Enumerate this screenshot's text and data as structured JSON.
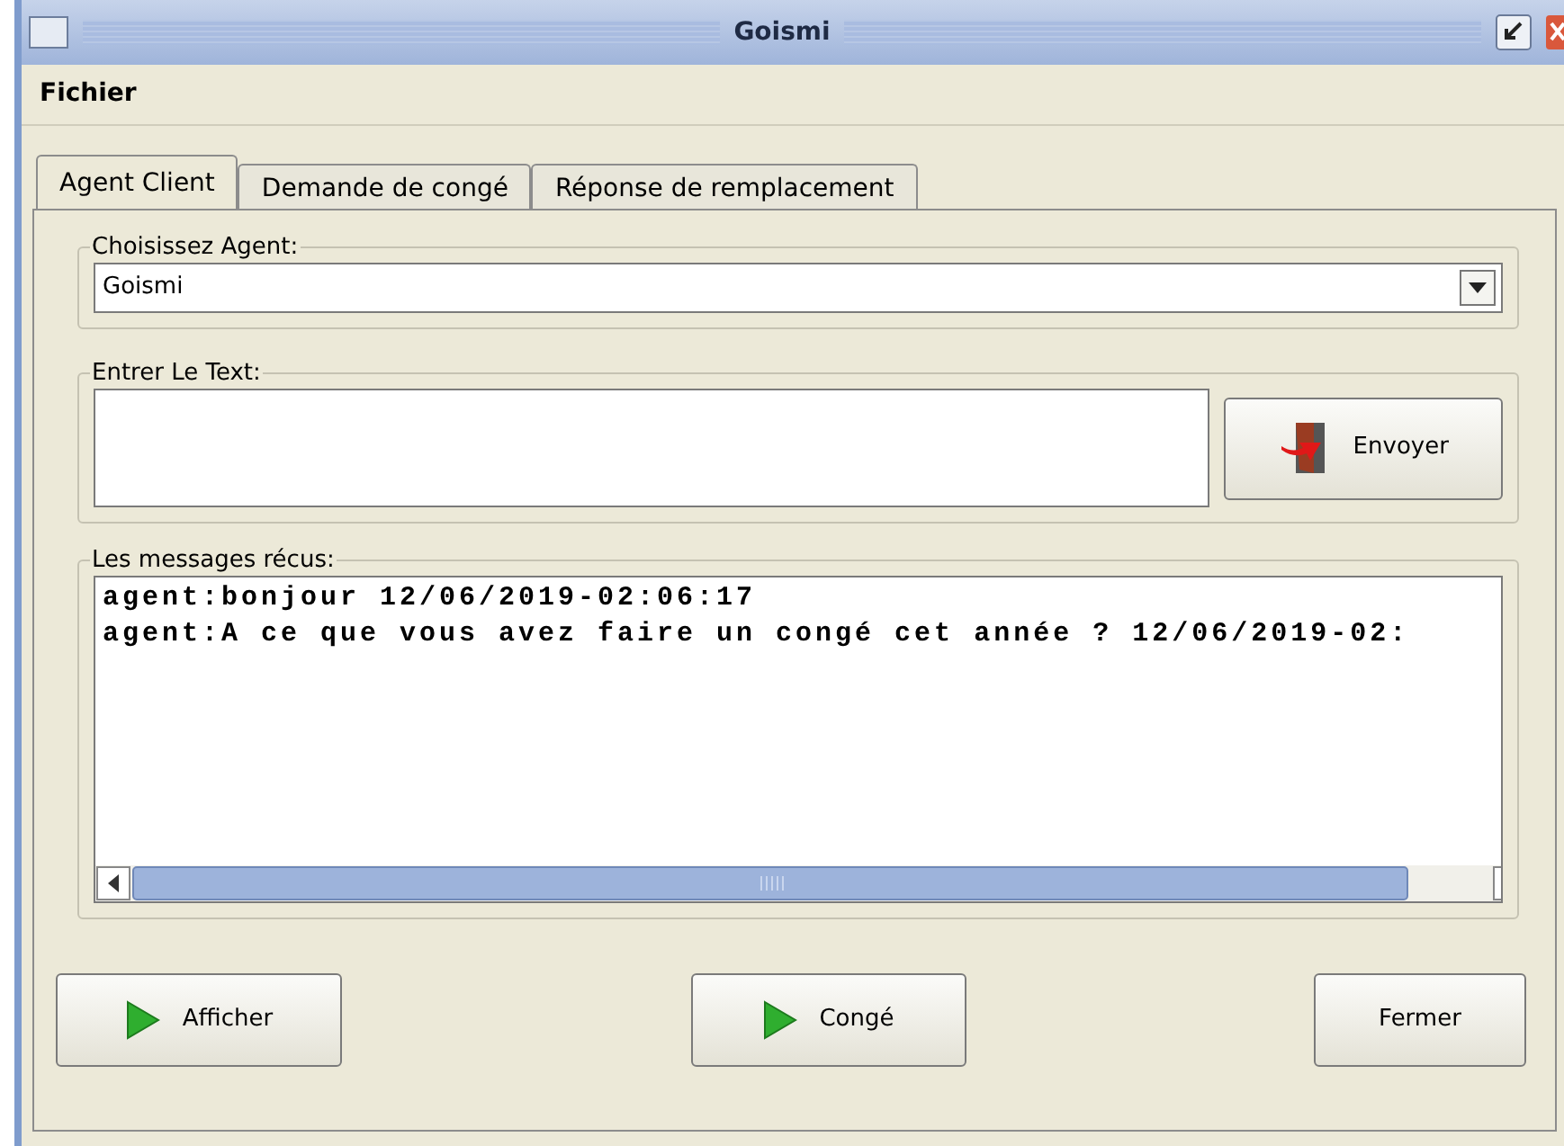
{
  "window": {
    "title": "Goismi"
  },
  "menu": [
    "Fichier"
  ],
  "tabs": [
    {
      "label": "Agent Client",
      "selected": true
    },
    {
      "label": "Demande de congé",
      "selected": false
    },
    {
      "label": "Réponse de remplacement",
      "selected": false
    }
  ],
  "agent_group": {
    "label": "Choisissez Agent:",
    "value": "Goismi"
  },
  "text_group": {
    "label": "Entrer Le Text:",
    "button": "Envoyer"
  },
  "messages_group": {
    "label": "Les messages récus:",
    "messages": [
      "agent:bonjour 12/06/2019-02:06:17",
      "agent:A ce que vous avez faire un congé cet année ? 12/06/2019-02:"
    ]
  },
  "buttons": [
    {
      "label": "Afficher",
      "kind": "play"
    },
    {
      "label": "Congé",
      "kind": "play"
    },
    {
      "label": "Fermer",
      "kind": "plain"
    }
  ]
}
